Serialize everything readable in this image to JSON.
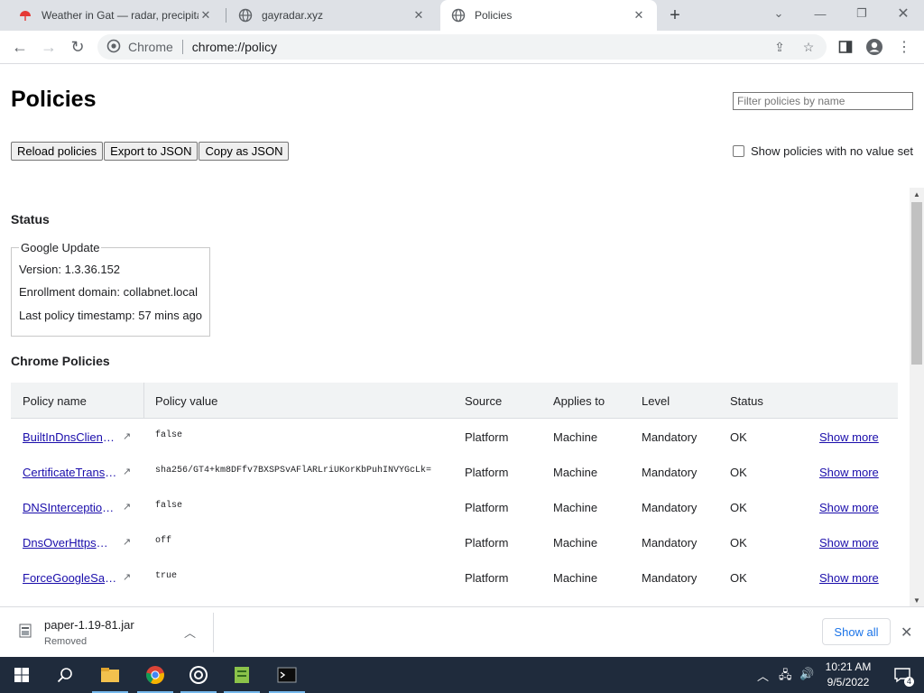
{
  "tabs": [
    {
      "title": "Weather in Gat — radar, precipitation",
      "icon": "weather-favicon-icon"
    },
    {
      "title": "gayradar.xyz",
      "icon": "globe-icon"
    },
    {
      "title": "Policies",
      "icon": "globe-icon"
    }
  ],
  "toolbar": {
    "omnibox_label": "Chrome",
    "url": "chrome://policy"
  },
  "page": {
    "title": "Policies",
    "filter_placeholder": "Filter policies by name",
    "buttons": {
      "reload": "Reload policies",
      "export": "Export to JSON",
      "copy": "Copy as JSON"
    },
    "no_value_checkbox": "Show policies with no value set",
    "status_heading": "Status",
    "google_update": {
      "legend": "Google Update",
      "version": "Version: 1.3.36.152",
      "enrollment": "Enrollment domain: collabnet.local",
      "timestamp": "Last policy timestamp: 57 mins ago"
    },
    "chrome_policies_heading": "Chrome Policies",
    "columns": [
      "Policy name",
      "Policy value",
      "Source",
      "Applies to",
      "Level",
      "Status"
    ],
    "rows": [
      {
        "name": "BuiltInDnsClientE...",
        "value": "false",
        "source": "Platform",
        "applies": "Machine",
        "level": "Mandatory",
        "status": "OK",
        "more": "Show more"
      },
      {
        "name": "CertificateTransp...",
        "value": "sha256/GT4+km8DFfv7BXSPSvAFlARLriUKorKbPuhINVYGcLk=",
        "source": "Platform",
        "applies": "Machine",
        "level": "Mandatory",
        "status": "OK",
        "more": "Show more"
      },
      {
        "name": "DNSInterception...",
        "value": "false",
        "source": "Platform",
        "applies": "Machine",
        "level": "Mandatory",
        "status": "OK",
        "more": "Show more"
      },
      {
        "name": "DnsOverHttpsMo...",
        "value": "off",
        "source": "Platform",
        "applies": "Machine",
        "level": "Mandatory",
        "status": "OK",
        "more": "Show more"
      },
      {
        "name": "ForceGoogleSafe...",
        "value": "true",
        "source": "Platform",
        "applies": "Machine",
        "level": "Mandatory",
        "status": "OK",
        "more": "Show more"
      }
    ]
  },
  "download": {
    "filename": "paper-1.19-81.jar",
    "status": "Removed",
    "show_all": "Show all"
  },
  "taskbar": {
    "time": "10:21 AM",
    "date": "9/5/2022",
    "notification_count": "4"
  },
  "colors": {
    "link": "#1a0dab",
    "taskbar_bg": "#1f2b3c",
    "tabstrip_bg": "#dee1e6"
  }
}
